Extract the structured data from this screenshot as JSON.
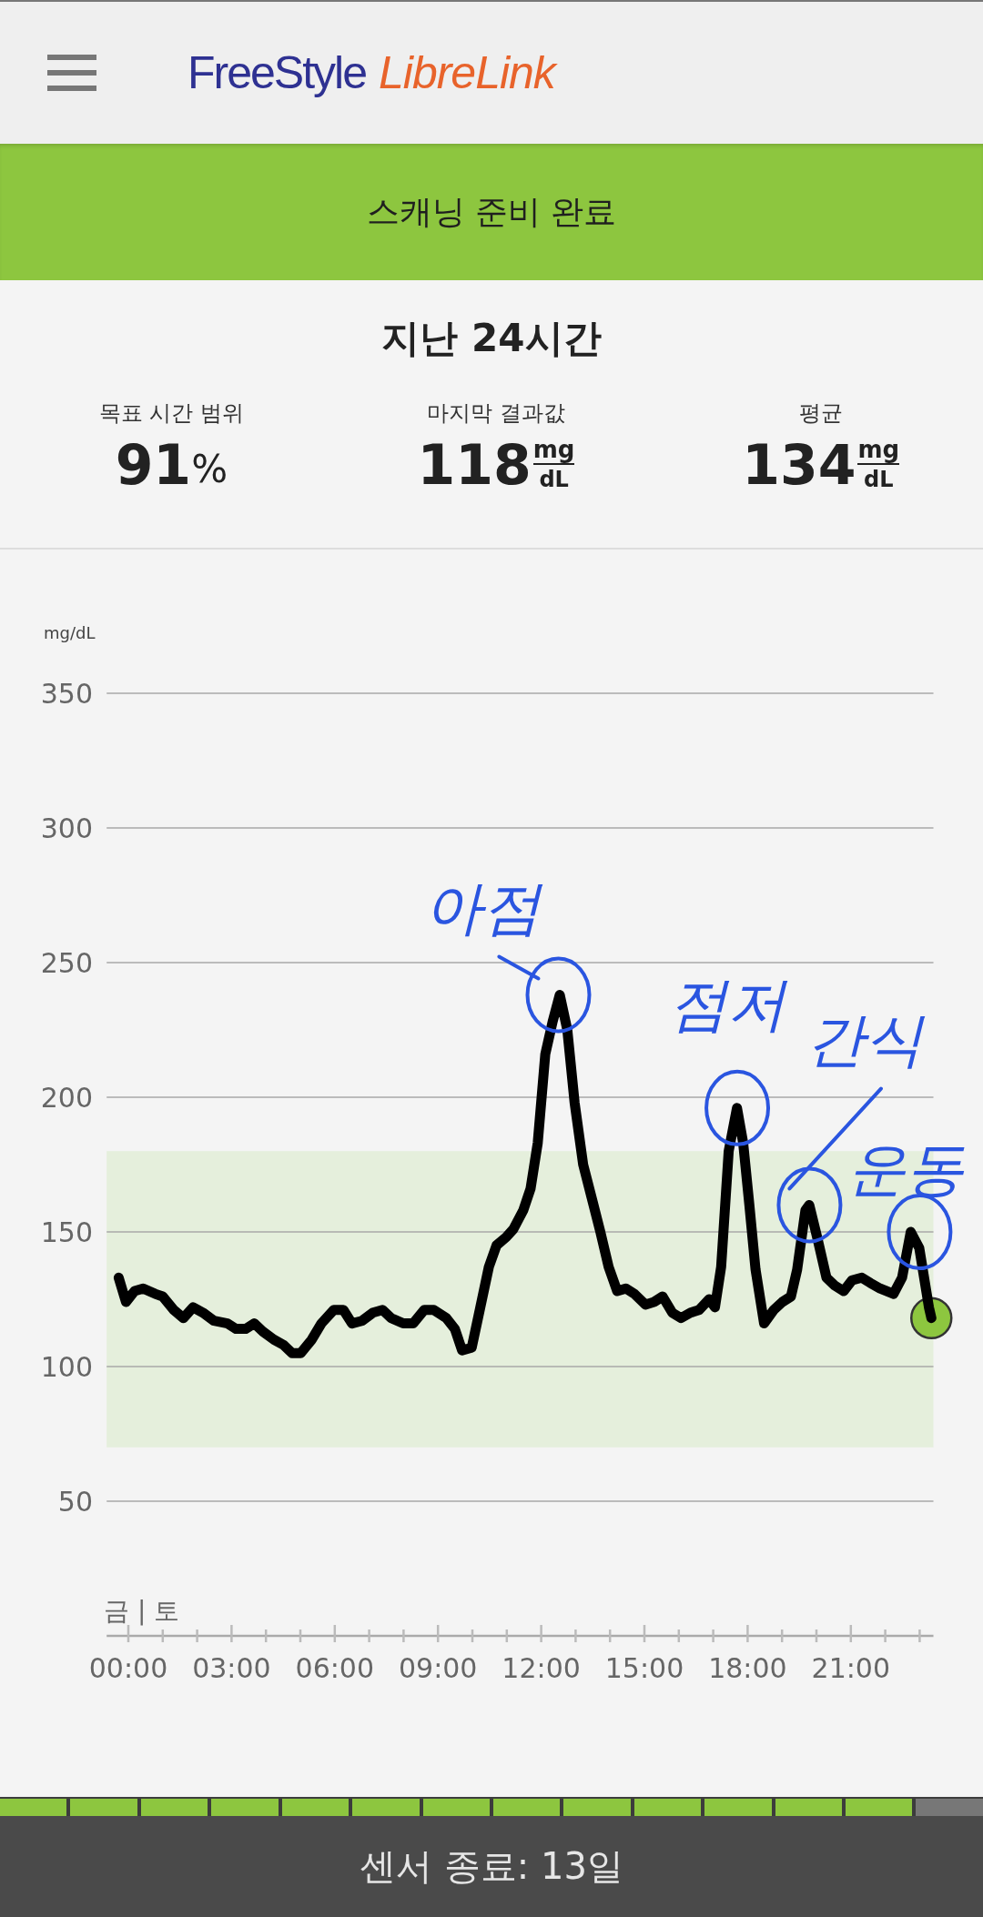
{
  "header": {
    "logo": {
      "brand": "FreeStyle",
      "product": "LibreLink"
    }
  },
  "banner": {
    "text": "스캐닝 준비 완료"
  },
  "summary": {
    "title": "지난 24시간",
    "stats": [
      {
        "kind": "percent",
        "label": "목표 시간 범위",
        "value": "91",
        "unit": "%"
      },
      {
        "kind": "fraction",
        "label": "마지막 결과값",
        "value": "118",
        "unit_top": "mg",
        "unit_bottom": "dL"
      },
      {
        "kind": "fraction",
        "label": "평균",
        "value": "134",
        "unit_top": "mg",
        "unit_bottom": "dL"
      }
    ]
  },
  "chart": {
    "day_label": "금 | 토",
    "chart_data": {
      "type": "line",
      "ylabel": "mg/dL",
      "xlim": [
        -0.63,
        23.4
      ],
      "ylim": [
        50,
        350
      ],
      "grid": true,
      "yticks": [
        50,
        100,
        150,
        200,
        250,
        300,
        350
      ],
      "xticks": [
        {
          "value": 0,
          "label": "00:00"
        },
        {
          "value": 3,
          "label": "03:00"
        },
        {
          "value": 6,
          "label": "06:00"
        },
        {
          "value": 9,
          "label": "09:00"
        },
        {
          "value": 12,
          "label": "12:00"
        },
        {
          "value": 15,
          "label": "15:00"
        },
        {
          "value": 18,
          "label": "18:00"
        },
        {
          "value": 21,
          "label": "21:00"
        }
      ],
      "bands": [
        {
          "axis": "y",
          "from": 70,
          "to": 180
        }
      ],
      "x": [
        -0.28,
        -0.07,
        0.18,
        0.43,
        0.78,
        1.0,
        1.32,
        1.6,
        1.88,
        2.17,
        2.49,
        2.88,
        3.13,
        3.41,
        3.66,
        3.91,
        4.23,
        4.51,
        4.76,
        5.01,
        5.33,
        5.61,
        5.97,
        6.25,
        6.5,
        6.79,
        7.11,
        7.39,
        7.64,
        7.99,
        8.28,
        8.6,
        8.88,
        9.24,
        9.49,
        9.7,
        9.98,
        10.23,
        10.48,
        10.7,
        10.98,
        11.19,
        11.48,
        11.69,
        11.9,
        12.12,
        12.33,
        12.54,
        12.76,
        12.97,
        13.22,
        13.5,
        13.72,
        13.96,
        14.21,
        14.46,
        14.71,
        15.03,
        15.28,
        15.53,
        15.81,
        16.06,
        16.34,
        16.59,
        16.88,
        17.05,
        17.23,
        17.45,
        17.69,
        17.87,
        18.05,
        18.23,
        18.48,
        18.76,
        19.01,
        19.26,
        19.44,
        19.68,
        19.79,
        20.04,
        20.29,
        20.54,
        20.79,
        21.03,
        21.32,
        21.57,
        21.85,
        22.24,
        22.49,
        22.74,
        22.99,
        23.27,
        23.34
      ],
      "series": [
        {
          "color": "#000000",
          "values": [
            133,
            124,
            128,
            129,
            127,
            126,
            121,
            118,
            122,
            120,
            117,
            116,
            114,
            114,
            116,
            113,
            110,
            108,
            105,
            105,
            110,
            116,
            121,
            121,
            116,
            117,
            120,
            121,
            118,
            116,
            116,
            121,
            121,
            118,
            114,
            106,
            107,
            122,
            137,
            145,
            148,
            151,
            158,
            166,
            183,
            216,
            228,
            238,
            225,
            198,
            175,
            161,
            150,
            137,
            128,
            129,
            127,
            123,
            124,
            126,
            120,
            118,
            120,
            121,
            125,
            122,
            137,
            180,
            196,
            183,
            160,
            136,
            116,
            121,
            124,
            126,
            136,
            158,
            160,
            147,
            133,
            130,
            128,
            132,
            133,
            131,
            129,
            127,
            133,
            150,
            144,
            122,
            118
          ]
        }
      ],
      "annotations": [
        "아점",
        "점저",
        "간식",
        "운동"
      ]
    }
  },
  "sensor": {
    "segments": [
      {
        "filled": true
      },
      {
        "filled": true
      },
      {
        "filled": true
      },
      {
        "filled": true
      },
      {
        "filled": true
      },
      {
        "filled": true
      },
      {
        "filled": true
      },
      {
        "filled": true
      },
      {
        "filled": true
      },
      {
        "filled": true
      },
      {
        "filled": true
      },
      {
        "filled": true
      },
      {
        "filled": true
      },
      {
        "filled": false
      }
    ],
    "status": "센서 종료: 13일"
  }
}
